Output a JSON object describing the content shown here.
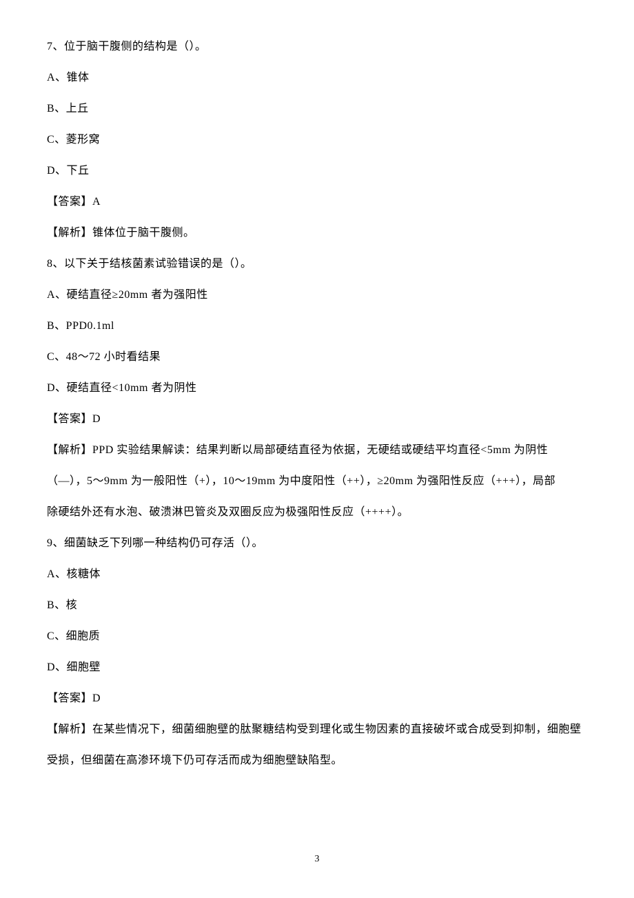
{
  "q7": {
    "stem": "7、位于脑干腹侧的结构是（）。",
    "optA": "A、锥体",
    "optB": "B、上丘",
    "optC": "C、菱形窝",
    "optD": "D、下丘",
    "answer": "【答案】A",
    "analysis": "【解析】锥体位于脑干腹侧。"
  },
  "q8": {
    "stem": "8、以下关于结核菌素试验错误的是（）。",
    "optA": "A、硬结直径≥20mm 者为强阳性",
    "optB": "B、PPD0.1ml",
    "optC": "C、48～72 小时看结果",
    "optD": "D、硬结直径<10mm 者为阴性",
    "answer": "【答案】D",
    "analysis1": "【解析】PPD 实验结果解读：结果判断以局部硬结直径为依据，无硬结或硬结平均直径<5mm 为阴性",
    "analysis2": "（—），5～9mm 为一般阳性（+），10～19mm 为中度阳性（++），≥20mm 为强阳性反应（+++），局部",
    "analysis3": "除硬结外还有水泡、破溃淋巴管炎及双圈反应为极强阳性反应（++++）。"
  },
  "q9": {
    "stem": "9、细菌缺乏下列哪一种结构仍可存活（）。",
    "optA": "A、核糖体",
    "optB": "B、核",
    "optC": "C、细胞质",
    "optD": "D、细胞壁",
    "answer": "【答案】D",
    "analysis1": "【解析】在某些情况下，细菌细胞壁的肽聚糖结构受到理化或生物因素的直接破坏或合成受到抑制，细胞壁",
    "analysis2": "受损，但细菌在高渗环境下仍可存活而成为细胞壁缺陷型。"
  },
  "pageNumber": "3"
}
